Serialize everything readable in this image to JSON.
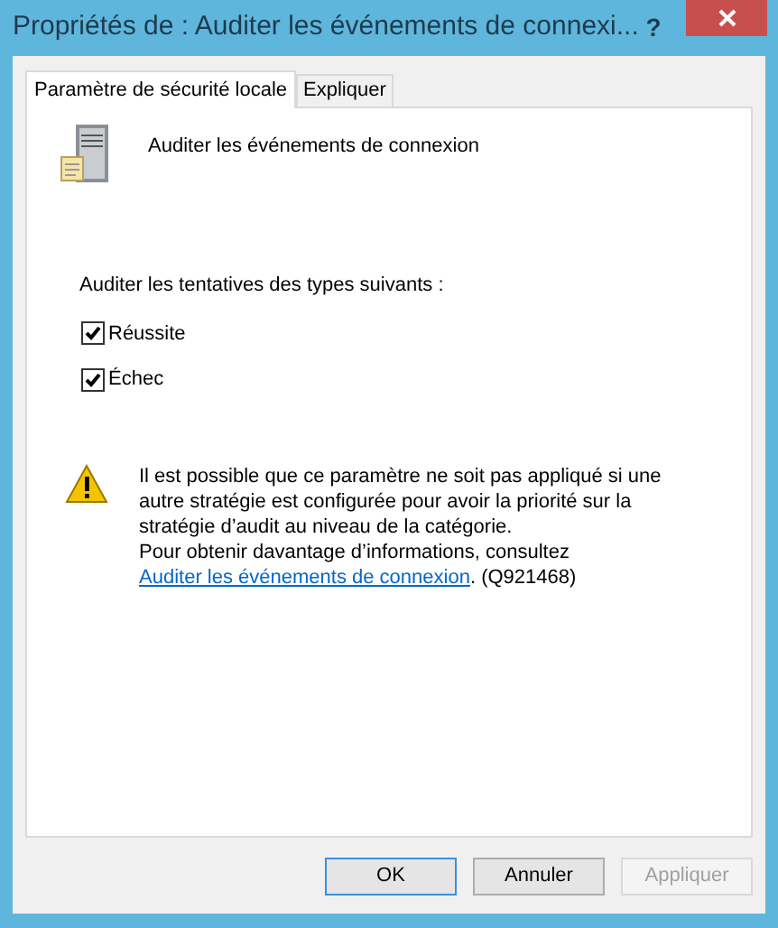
{
  "window": {
    "title": "Propriétés de : Auditer les événements de connexi...",
    "help": "?"
  },
  "tabs": [
    {
      "label": "Paramètre de sécurité locale",
      "selected": true
    },
    {
      "label": "Expliquer",
      "selected": false
    }
  ],
  "policy": {
    "name": "Auditer les événements de connexion"
  },
  "audit": {
    "label": "Auditer les tentatives des types suivants :",
    "options": [
      {
        "label": "Réussite",
        "checked": true
      },
      {
        "label": "Échec",
        "checked": true
      }
    ]
  },
  "warning": {
    "text": "Il est possible que ce paramètre ne soit pas appliqué si une autre stratégie est configurée pour avoir la priorité sur la stratégie d’audit au niveau de la catégorie.",
    "more": "Pour obtenir davantage d’informations, consultez ",
    "link": "Auditer les événements de connexion",
    "suffix": ". (Q921468)"
  },
  "buttons": [
    {
      "label": "OK",
      "disabled": false,
      "default": true
    },
    {
      "label": "Annuler",
      "disabled": false,
      "default": false
    },
    {
      "label": "Appliquer",
      "disabled": true,
      "default": false
    }
  ]
}
